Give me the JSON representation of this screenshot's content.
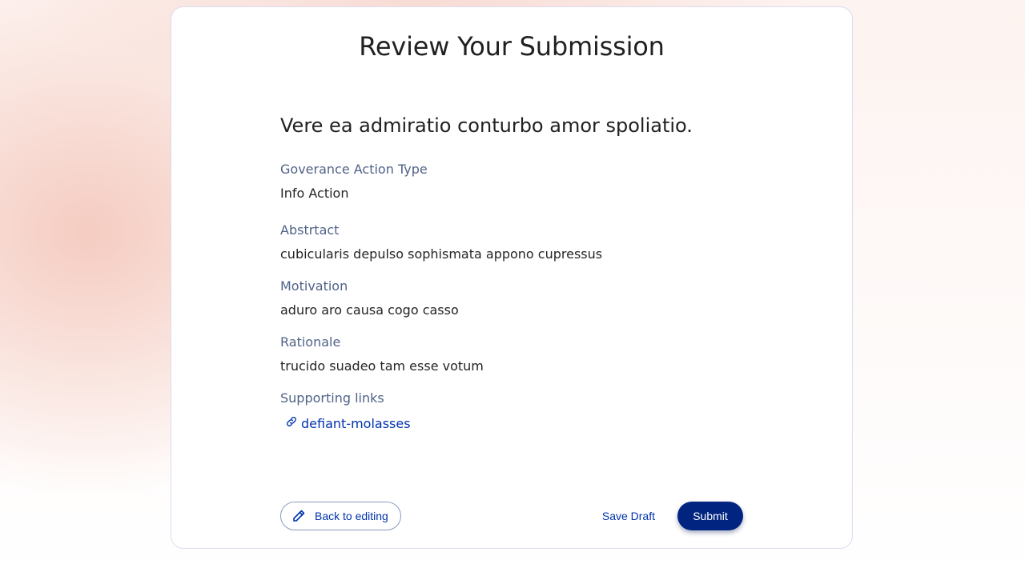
{
  "page": {
    "title": "Review Your Submission"
  },
  "proposal": {
    "title": "Vere ea admiratio conturbo amor spoliatio.",
    "fields": [
      {
        "label": "Goverance Action Type",
        "value": "Info Action"
      },
      {
        "label": "Abstrtact",
        "value": "cubicularis depulso sophismata appono cupressus"
      },
      {
        "label": "Motivation",
        "value": "aduro aro causa cogo casso"
      },
      {
        "label": "Rationale",
        "value": "trucido suadeo tam esse votum"
      }
    ],
    "links": {
      "label": "Supporting links",
      "items": [
        {
          "text": "defiant-molasses",
          "icon": "link-icon"
        }
      ]
    }
  },
  "actions": {
    "back": {
      "label": "Back to editing",
      "icon": "pencil-icon"
    },
    "save_draft": {
      "label": "Save Draft"
    },
    "submit": {
      "label": "Submit"
    }
  },
  "colors": {
    "primary": "#0033ad",
    "submit_bg": "#002480",
    "label": "#506288",
    "text": "#242424"
  }
}
